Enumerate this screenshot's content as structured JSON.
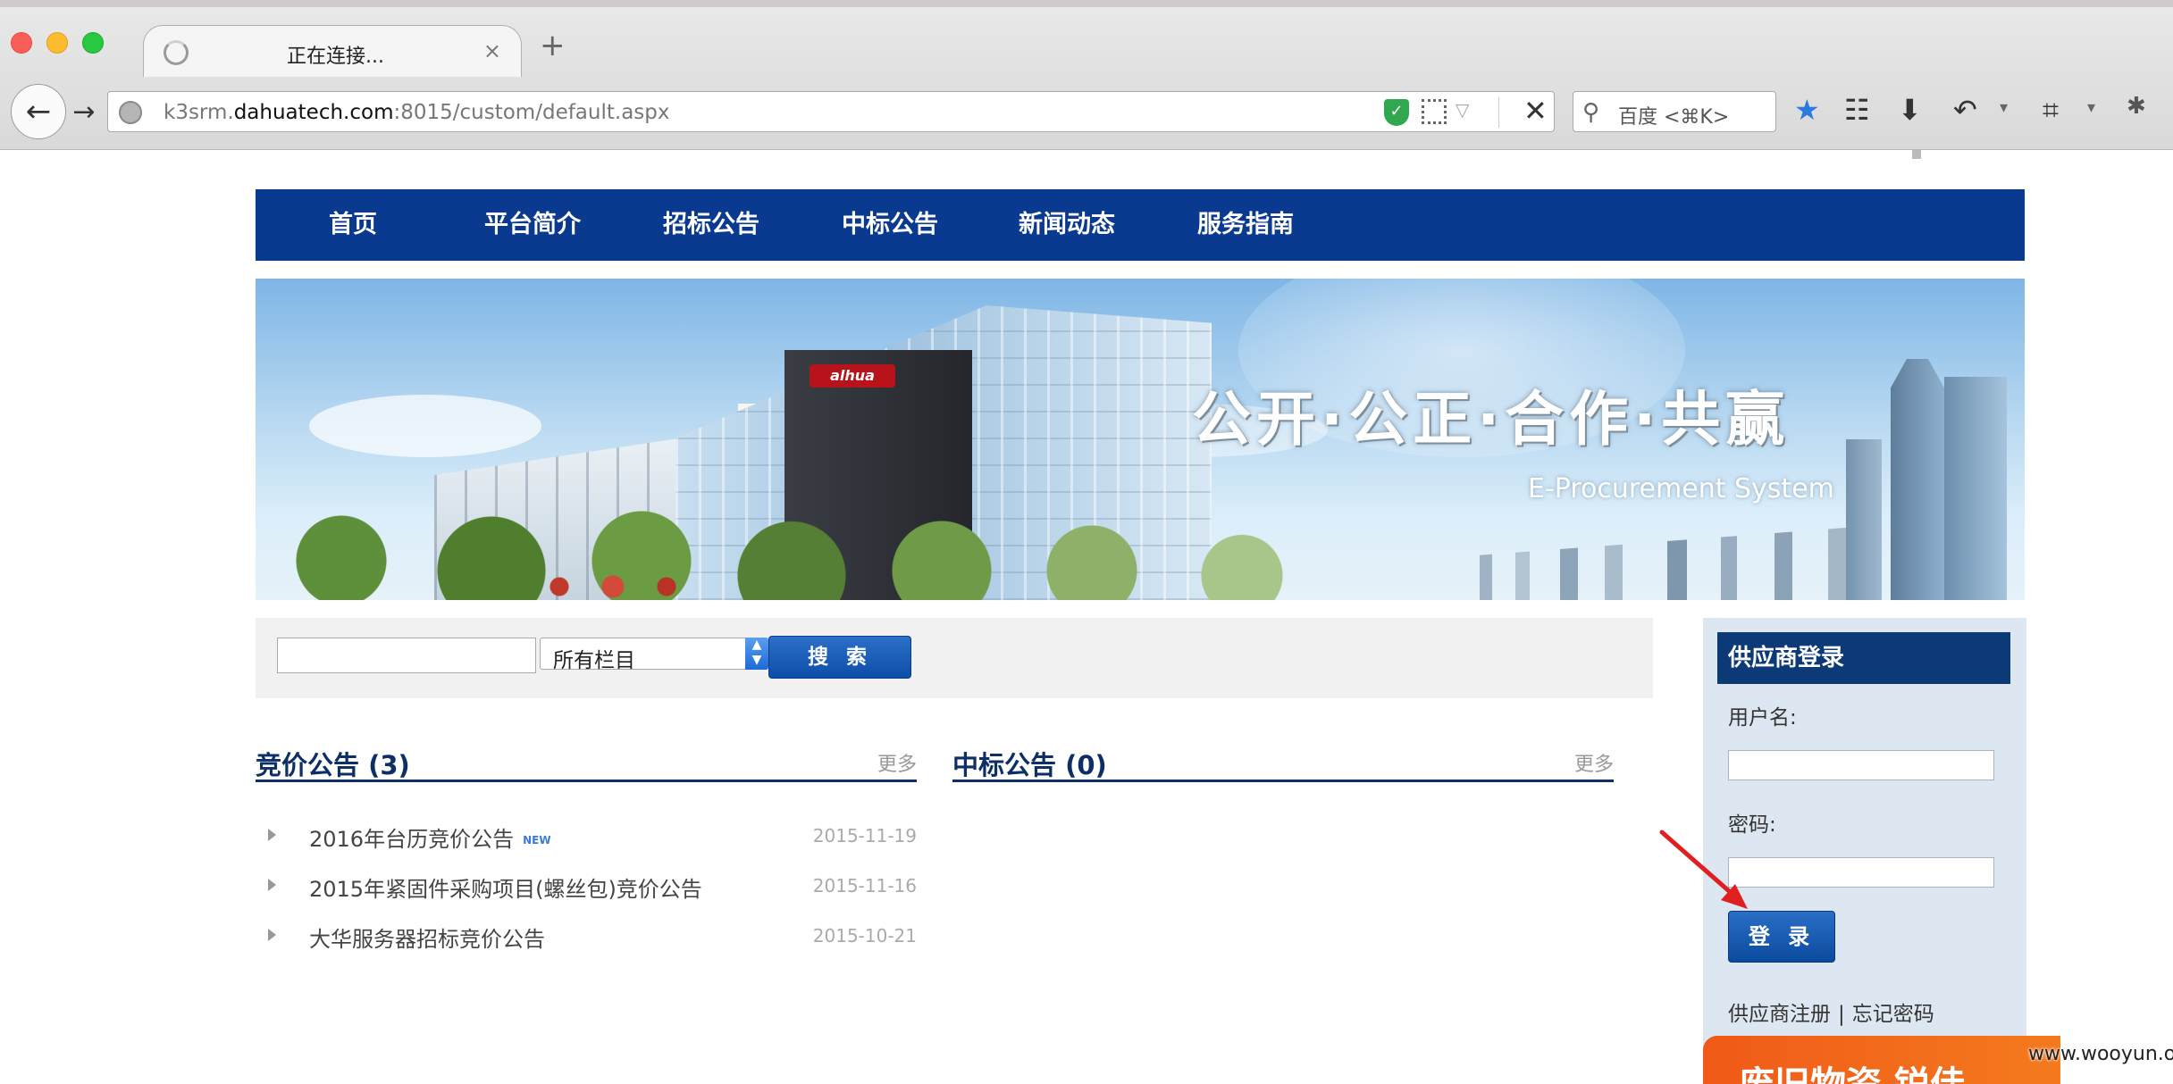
{
  "browser": {
    "tab_title": "正在连接...",
    "tab_close": "×",
    "new_tab": "+",
    "url_prefix": "k3srm.",
    "url_domain": "dahuatech.com",
    "url_suffix": ":8015/custom/default.aspx",
    "search_placeholder": "百度 <⌘K>",
    "icons": [
      "back-icon",
      "forward-icon",
      "globe-icon",
      "shield-icon",
      "qr-code-icon",
      "dropdown-icon",
      "stop-icon",
      "search-icon",
      "bookmark-star-icon",
      "reading-list-icon",
      "download-icon",
      "undo-icon",
      "crop-icon",
      "bug-icon"
    ]
  },
  "nav": {
    "items": [
      "首页",
      "平台简介",
      "招标公告",
      "中标公告",
      "新闻动态",
      "服务指南"
    ]
  },
  "banner": {
    "slogan": "公开·公正·合作·共赢",
    "subtitle": "E-Procurement System",
    "logo_text": "alhua"
  },
  "search": {
    "select_value": "所有栏目",
    "button_label": "搜 索"
  },
  "bid_section": {
    "title": "竞价公告 (3)",
    "more": "更多",
    "items": [
      {
        "title": "2016年台历竞价公告",
        "badge": "NEW",
        "date": "2015-11-19"
      },
      {
        "title": "2015年紧固件采购项目(螺丝包)竞价公告",
        "date": "2015-11-16"
      },
      {
        "title": "大华服务器招标竞价公告",
        "date": "2015-10-21"
      }
    ]
  },
  "win_section": {
    "title": "中标公告 (0)",
    "more": "更多"
  },
  "login": {
    "title": "供应商登录",
    "username_label": "用户名:",
    "password_label": "密码:",
    "button_label": "登 录",
    "register_link": "供应商注册",
    "separator": "|",
    "forgot_link": "忘记密码"
  },
  "promo": {
    "text": "废旧物资  锐佳"
  },
  "watermark": "www.wooyun.org",
  "colors": {
    "nav_bg": "#0a3a8f",
    "login_head": "#0b3a76",
    "button_blue": "#0d4ea9",
    "promo_orange": "#f05a18",
    "annotation_arrow": "#e02020"
  }
}
